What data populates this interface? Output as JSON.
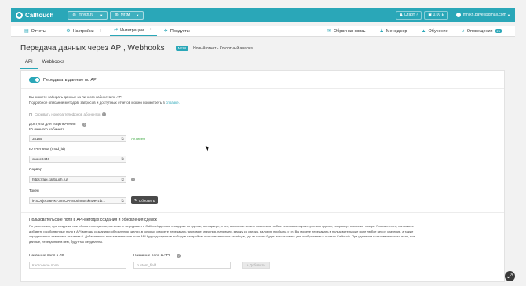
{
  "topbar": {
    "logo": "Calltouch",
    "site_button": "mrykn.ru",
    "site_button2": "Мгкм",
    "start": "Старт",
    "balance": "0.00 ₽",
    "user_email": "mrykn.pavel@gmail.com"
  },
  "nav": {
    "items": [
      {
        "label": "Отчеты"
      },
      {
        "label": "Настройки"
      },
      {
        "label": "Интеграции"
      },
      {
        "label": "Продукты"
      }
    ],
    "right": [
      {
        "label": "Обратная связь"
      },
      {
        "label": "Менеджер"
      },
      {
        "label": "Обучение"
      },
      {
        "label": "Оповещения",
        "badge": "26"
      }
    ]
  },
  "page": {
    "title": "Передача данных через API, Webhooks",
    "new_tag": "NEW",
    "new_text": "Новый отчет - Когортный анализ"
  },
  "tabs": [
    "API",
    "Webhooks"
  ],
  "api": {
    "toggle_label": "Передавать данные по API",
    "info_line1": "Вы можете забирать данные из личного кабинета по API",
    "info_line2_prefix": "Подробное описание методов, запросов и доступных отчетов можно посмотреть в",
    "info_link": "справке.",
    "hide_phones": "Скрывать номера телефонов абонентов",
    "access_title": "Доступы для подключения",
    "cabinet_id_label": "ID личного кабинета",
    "cabinet_id_value": "38185",
    "status_active": "Активен",
    "counter_label": "ID счетчика (mod_id)",
    "counter_value": "cnoke9446",
    "server_label": "Сервер",
    "server_value": "https://api.calltouch.ru/",
    "token_label": "Токен",
    "token_value": "iHSO5jtRS6HKF3mrCPP8C6lnn54tknDevzib...",
    "refresh_button": "Обновить",
    "custom_title": "Пользовательские поля в API-методах создания и обновления сделок",
    "custom_text1": "По умолчанию, при создании или обновлении сделки, вы можете передавать в Calltouch данные о выручке со сделки, менеджере, и тех, в которые можно поместить любые текстовые характеристики сделки, например, описание товара. Помимо этого, вы можете",
    "custom_text2": "добавить и собственные поля в API-методы создания и обновления сделки, в которых сможете передавать числовые значения, например, маржу со сделки, валовую прибыль и т.п. Вы можете передавать в пользовательские поле любое целое значение, а также",
    "custom_text3": "определенных значениях значение 0. Добавленные пользовательские поля API будут доступны в выбору в настройках пользовательских столбцов, где их можно будет использовать для отображения в отчетах Calltouch. При удалении пользовательского поля, все",
    "custom_text4": "данные, переданные в нем, будут так же удалены.",
    "field_lk_label": "Название поля в ЛК",
    "field_lk_placeholder": "Кастомное поле",
    "field_api_label": "Название поля в API",
    "field_api_placeholder": "custom_field",
    "add_button": "+ Добавить"
  }
}
